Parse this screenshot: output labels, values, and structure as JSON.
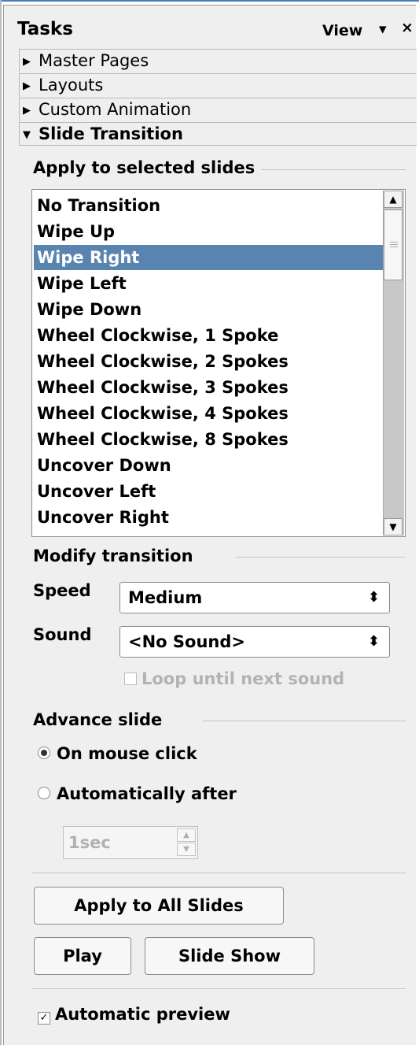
{
  "panel": {
    "title": "Tasks",
    "view_label": "View",
    "view_arrow": "▾",
    "close_glyph": "×"
  },
  "sections": [
    {
      "label": "Master Pages",
      "expanded": false
    },
    {
      "label": "Layouts",
      "expanded": false
    },
    {
      "label": "Custom Animation",
      "expanded": false
    },
    {
      "label": "Slide Transition",
      "expanded": true
    }
  ],
  "apply_group": {
    "label": "Apply to selected slides",
    "items": [
      "No Transition",
      "Wipe Up",
      "Wipe Right",
      "Wipe Left",
      "Wipe Down",
      "Wheel Clockwise, 1 Spoke",
      "Wheel Clockwise, 2 Spokes",
      "Wheel Clockwise, 3 Spokes",
      "Wheel Clockwise, 4 Spokes",
      "Wheel Clockwise, 8 Spokes",
      "Uncover Down",
      "Uncover Left",
      "Uncover Right"
    ],
    "selected": "Wipe Right"
  },
  "modify": {
    "label": "Modify transition",
    "speed_label": "Speed",
    "speed_value": "Medium",
    "sound_label": "Sound",
    "sound_value": "<No Sound>",
    "loop_label": "Loop until next sound",
    "loop_checked": false
  },
  "advance": {
    "label": "Advance slide",
    "on_click_label": "On mouse click",
    "auto_label": "Automatically after",
    "selected": "On mouse click",
    "auto_value": "1sec"
  },
  "buttons": {
    "apply_all": "Apply to All Slides",
    "play": "Play",
    "slide_show": "Slide Show"
  },
  "preview": {
    "label": "Automatic preview",
    "checked": true,
    "check_glyph": "✓"
  },
  "colors": {
    "selection": "#5a84b0",
    "panel_bg": "#efefef"
  }
}
